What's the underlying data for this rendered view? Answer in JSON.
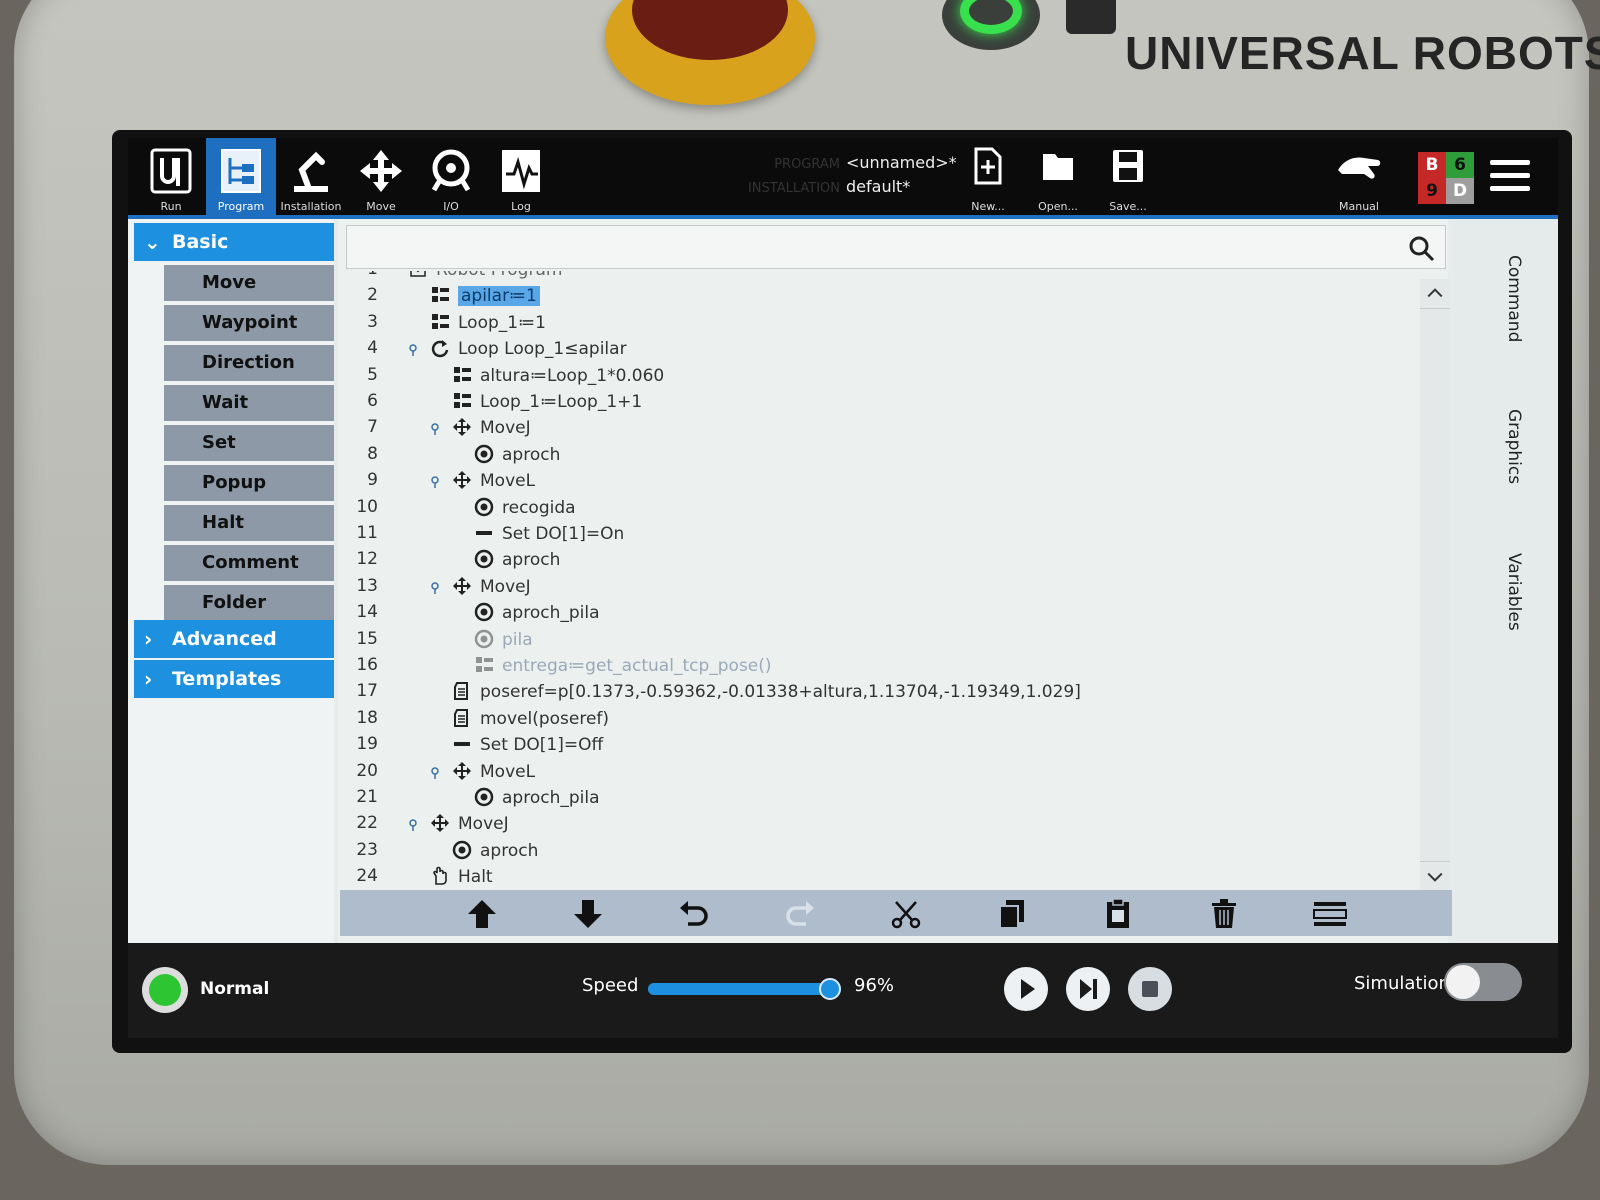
{
  "device": {
    "brand": "UNIVERSAL ROBOTS"
  },
  "topbar": {
    "nav": [
      {
        "label": "Run",
        "icon": "ur-logo-icon",
        "active": false
      },
      {
        "label": "Program",
        "icon": "program-tree-icon",
        "active": true
      },
      {
        "label": "Installation",
        "icon": "robot-arm-icon",
        "active": false
      },
      {
        "label": "Move",
        "icon": "move-arrows-icon",
        "active": false
      },
      {
        "label": "I/O",
        "icon": "io-icon",
        "active": false
      },
      {
        "label": "Log",
        "icon": "log-chart-icon",
        "active": false
      }
    ],
    "program_caption": "PROGRAM",
    "program_name": "<unnamed>*",
    "installation_caption": "INSTALLATION",
    "installation_name": "default*",
    "file_actions": [
      {
        "label": "New...",
        "icon": "new-file-icon"
      },
      {
        "label": "Open...",
        "icon": "open-folder-icon"
      },
      {
        "label": "Save...",
        "icon": "save-icon"
      }
    ],
    "mode": {
      "label": "Manual",
      "icon": "hand-icon"
    },
    "badge": {
      "tl": "B",
      "tr": "6",
      "bl": "9",
      "br": "D",
      "colors": {
        "tl": "#c62828",
        "tr": "#2e9d3a",
        "bl": "#c62828",
        "br": "#9e9e9e"
      }
    }
  },
  "sidebar": {
    "basic": {
      "label": "Basic",
      "expanded": true
    },
    "items": [
      "Move",
      "Waypoint",
      "Direction",
      "Wait",
      "Set",
      "Popup",
      "Halt",
      "Comment",
      "Folder"
    ],
    "advanced": {
      "label": "Advanced"
    },
    "templates": {
      "label": "Templates"
    }
  },
  "search": {
    "placeholder": ""
  },
  "tree": [
    {
      "n": "1",
      "text": "Robot Program",
      "icon": "expand",
      "indent": 0,
      "partial": true
    },
    {
      "n": "2",
      "text": "apilar≔1",
      "icon": "assign",
      "indent": 1,
      "selected": true
    },
    {
      "n": "3",
      "text": "Loop_1≔1",
      "icon": "assign",
      "indent": 1
    },
    {
      "n": "4",
      "text": "Loop Loop_1≤apilar",
      "icon": "loop",
      "indent": 1,
      "expander": true
    },
    {
      "n": "5",
      "text": "altura≔Loop_1*0.060",
      "icon": "assign",
      "indent": 2
    },
    {
      "n": "6",
      "text": "Loop_1≔Loop_1+1",
      "icon": "assign",
      "indent": 2
    },
    {
      "n": "7",
      "text": "MoveJ",
      "icon": "move",
      "indent": 2,
      "expander": true
    },
    {
      "n": "8",
      "text": "aproch",
      "icon": "waypoint",
      "indent": 3
    },
    {
      "n": "9",
      "text": "MoveL",
      "icon": "move",
      "indent": 2,
      "expander": true
    },
    {
      "n": "10",
      "text": "recogida",
      "icon": "waypoint",
      "indent": 3
    },
    {
      "n": "11",
      "text": "Set DO[1]=On",
      "icon": "set",
      "indent": 3
    },
    {
      "n": "12",
      "text": "aproch",
      "icon": "waypoint",
      "indent": 3
    },
    {
      "n": "13",
      "text": "MoveJ",
      "icon": "move",
      "indent": 2,
      "expander": true
    },
    {
      "n": "14",
      "text": "aproch_pila",
      "icon": "waypoint",
      "indent": 3
    },
    {
      "n": "15",
      "text": "pila",
      "icon": "waypoint",
      "indent": 3,
      "faded": true
    },
    {
      "n": "16",
      "text": "entrega≔get_actual_tcp_pose()",
      "icon": "assign",
      "indent": 3,
      "faded": true
    },
    {
      "n": "17",
      "text": "poseref=p[0.1373,-0.59362,-0.01338+altura,1.13704,-1.19349,1.029]",
      "icon": "script",
      "indent": 2
    },
    {
      "n": "18",
      "text": "movel(poseref)",
      "icon": "script",
      "indent": 2
    },
    {
      "n": "19",
      "text": "Set DO[1]=Off",
      "icon": "set",
      "indent": 2
    },
    {
      "n": "20",
      "text": "MoveL",
      "icon": "move",
      "indent": 2,
      "expander": true
    },
    {
      "n": "21",
      "text": "aproch_pila",
      "icon": "waypoint",
      "indent": 3
    },
    {
      "n": "22",
      "text": "MoveJ",
      "icon": "move",
      "indent": 1,
      "expander": true
    },
    {
      "n": "23",
      "text": "aproch",
      "icon": "waypoint",
      "indent": 2
    },
    {
      "n": "24",
      "text": "Halt",
      "icon": "halt",
      "indent": 1
    }
  ],
  "edit_tools": [
    {
      "name": "move-up-icon",
      "enabled": true
    },
    {
      "name": "move-down-icon",
      "enabled": true
    },
    {
      "name": "undo-icon",
      "enabled": true
    },
    {
      "name": "redo-icon",
      "enabled": false
    },
    {
      "name": "cut-icon",
      "enabled": true
    },
    {
      "name": "copy-icon",
      "enabled": true
    },
    {
      "name": "paste-icon",
      "enabled": true
    },
    {
      "name": "delete-icon",
      "enabled": true
    },
    {
      "name": "suppress-icon",
      "enabled": true
    }
  ],
  "right_tabs": [
    "Command",
    "Graphics",
    "Variables"
  ],
  "footer": {
    "status": "Normal",
    "status_color": "#2ec532",
    "speed_label": "Speed",
    "speed_value": "96%",
    "speed_fraction": 0.96,
    "simulation_label": "Simulation",
    "simulation_on": false
  }
}
